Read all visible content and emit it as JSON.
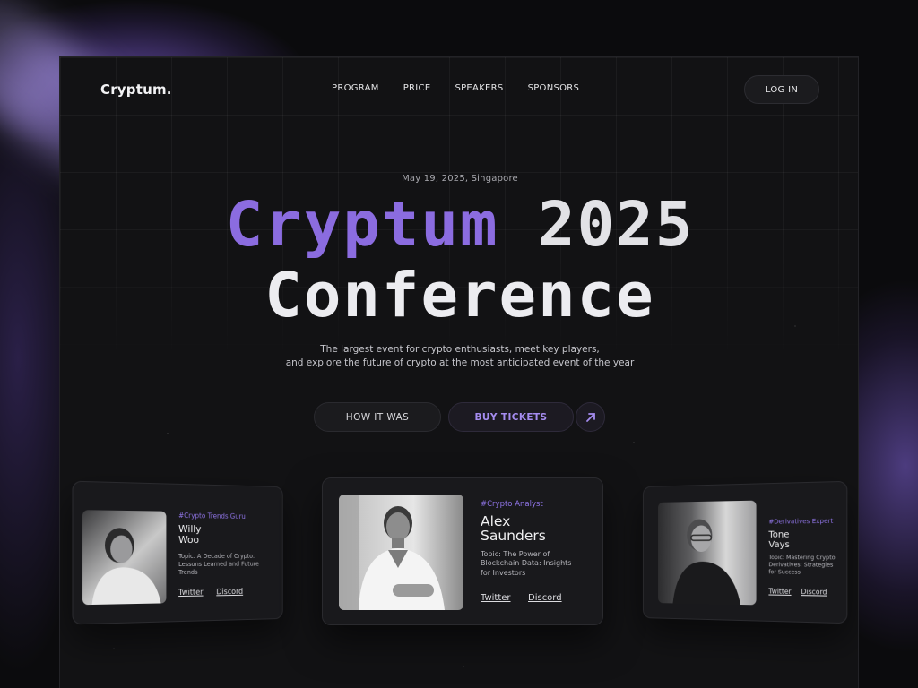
{
  "header": {
    "logo": "Cryptum.",
    "nav": [
      "PROGRAM",
      "PRICE",
      "SPEAKERS",
      "SPONSORS"
    ],
    "login_label": "LOG IN"
  },
  "hero": {
    "date_location": "May 19, 2025,  Singapore",
    "title_accent": "Cryptum",
    "title_year": "2025",
    "title_line2": "Conference",
    "subtitle_line1": "The largest event for crypto enthusiasts, meet key players,",
    "subtitle_line2": "and explore the future of crypto at the most anticipated event of the year",
    "accent_color": "#8b6ce0"
  },
  "actions": {
    "how_it_was": "HOW IT WAS",
    "buy_tickets": "BUY TICKETS",
    "arrow_icon": "arrow-up-right-icon"
  },
  "speakers": [
    {
      "tag": "#Crypto Trends Guru",
      "name_line1": "Willy",
      "name_line2": "Woo",
      "topic": "Topic: A Decade of Crypto: Lessons Learned and Future Trends",
      "twitter": "Twitter",
      "discord": "Discord"
    },
    {
      "tag": "#Crypto Analyst",
      "name_line1": "Alex",
      "name_line2": "Saunders",
      "topic": "Topic: The Power of Blockchain Data: Insights for Investors",
      "twitter": "Twitter",
      "discord": "Discord"
    },
    {
      "tag": "#Derivatives Expert",
      "name_line1": "Tone",
      "name_line2": "Vays",
      "topic": "Topic: Mastering Crypto Derivatives: Strategies for Success",
      "twitter": "Twitter",
      "discord": "Discord"
    }
  ]
}
